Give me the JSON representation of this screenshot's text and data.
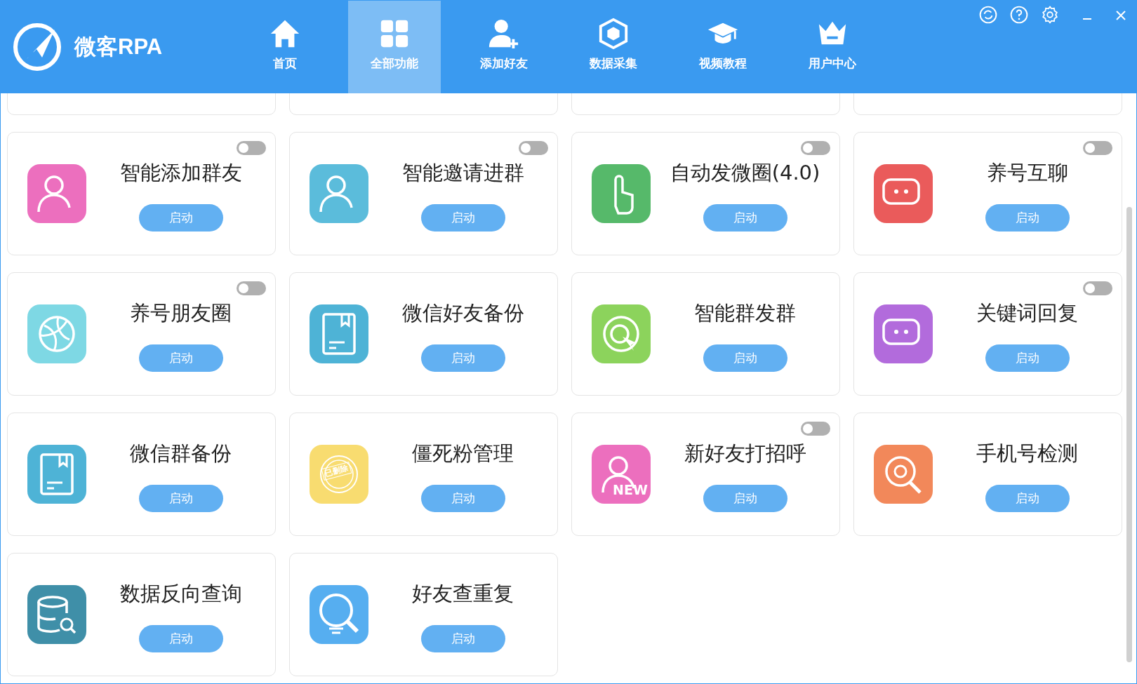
{
  "app": {
    "name": "微客RPA"
  },
  "nav": [
    {
      "label": "首页",
      "selected": false
    },
    {
      "label": "全部功能",
      "selected": true
    },
    {
      "label": "添加好友",
      "selected": false
    },
    {
      "label": "数据采集",
      "selected": false
    },
    {
      "label": "视频教程",
      "selected": false
    },
    {
      "label": "用户中心",
      "selected": false
    }
  ],
  "cards": [
    {
      "title": "智能添加群友",
      "button": "启动",
      "toggle": {
        "on": false
      }
    },
    {
      "title": "智能邀请进群",
      "button": "启动",
      "toggle": {
        "on": false
      }
    },
    {
      "title": "自动发微圈(4.0)",
      "button": "启动",
      "toggle": {
        "on": false
      }
    },
    {
      "title": "养号互聊",
      "button": "启动",
      "toggle": {
        "on": false
      }
    },
    {
      "title": "养号朋友圈",
      "button": "启动",
      "toggle": {
        "on": false
      }
    },
    {
      "title": "微信好友备份",
      "button": "启动"
    },
    {
      "title": "智能群发群",
      "button": "启动"
    },
    {
      "title": "关键词回复",
      "button": "启动",
      "toggle": {
        "on": false
      }
    },
    {
      "title": "微信群备份",
      "button": "启动"
    },
    {
      "title": "僵死粉管理",
      "button": "启动",
      "icon_text": "已删除"
    },
    {
      "title": "新好友打招呼",
      "button": "启动",
      "toggle": {
        "on": false
      },
      "icon_text": "NEW"
    },
    {
      "title": "手机号检测",
      "button": "启动"
    },
    {
      "title": "数据反向查询",
      "button": "启动"
    },
    {
      "title": "好友查重复",
      "button": "启动"
    }
  ]
}
